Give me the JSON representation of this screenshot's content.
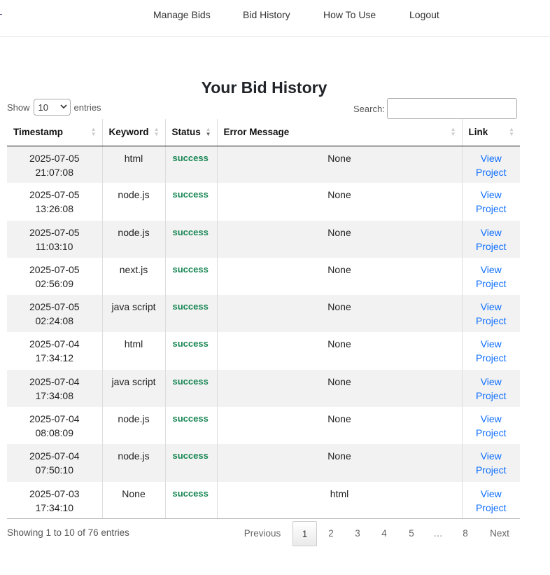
{
  "nav": {
    "items": [
      "Manage Bids",
      "Bid History",
      "How To Use",
      "Logout"
    ]
  },
  "page": {
    "title": "Your Bid History"
  },
  "controls": {
    "show_label": "Show",
    "entries_value": "10",
    "entries_label": "entries",
    "search_label": "Search:",
    "search_value": ""
  },
  "table": {
    "columns": [
      "Timestamp",
      "Keyword",
      "Status",
      "Error Message",
      "Link"
    ],
    "rows": [
      {
        "date": "2025-07-05",
        "time": "21:07:08",
        "keyword": "html",
        "status": "success",
        "error": "None",
        "link1": "View",
        "link2": "Project"
      },
      {
        "date": "2025-07-05",
        "time": "13:26:08",
        "keyword": "node.js",
        "status": "success",
        "error": "None",
        "link1": "View",
        "link2": "Project"
      },
      {
        "date": "2025-07-05",
        "time": "11:03:10",
        "keyword": "node.js",
        "status": "success",
        "error": "None",
        "link1": "View",
        "link2": "Project"
      },
      {
        "date": "2025-07-05",
        "time": "02:56:09",
        "keyword": "next.js",
        "status": "success",
        "error": "None",
        "link1": "View",
        "link2": "Project"
      },
      {
        "date": "2025-07-05",
        "time": "02:24:08",
        "keyword": "java script",
        "status": "success",
        "error": "None",
        "link1": "View",
        "link2": "Project"
      },
      {
        "date": "2025-07-04",
        "time": "17:34:12",
        "keyword": "html",
        "status": "success",
        "error": "None",
        "link1": "View",
        "link2": "Project"
      },
      {
        "date": "2025-07-04",
        "time": "17:34:08",
        "keyword": "java script",
        "status": "success",
        "error": "None",
        "link1": "View",
        "link2": "Project"
      },
      {
        "date": "2025-07-04",
        "time": "08:08:09",
        "keyword": "node.js",
        "status": "success",
        "error": "None",
        "link1": "View",
        "link2": "Project"
      },
      {
        "date": "2025-07-04",
        "time": "07:50:10",
        "keyword": "node.js",
        "status": "success",
        "error": "None",
        "link1": "View",
        "link2": "Project"
      },
      {
        "date": "2025-07-03",
        "time": "17:34:10",
        "keyword": "None",
        "status": "success",
        "error": "html",
        "link1": "View",
        "link2": "Project"
      }
    ]
  },
  "footer": {
    "info": "Showing 1 to 10 of 76 entries",
    "pagination": [
      "Previous",
      "1",
      "2",
      "3",
      "4",
      "5",
      "…",
      "8",
      "Next"
    ]
  },
  "colors": {
    "success": "#198754",
    "link": "#0d6efd",
    "stripe": "#f2f2f2"
  }
}
